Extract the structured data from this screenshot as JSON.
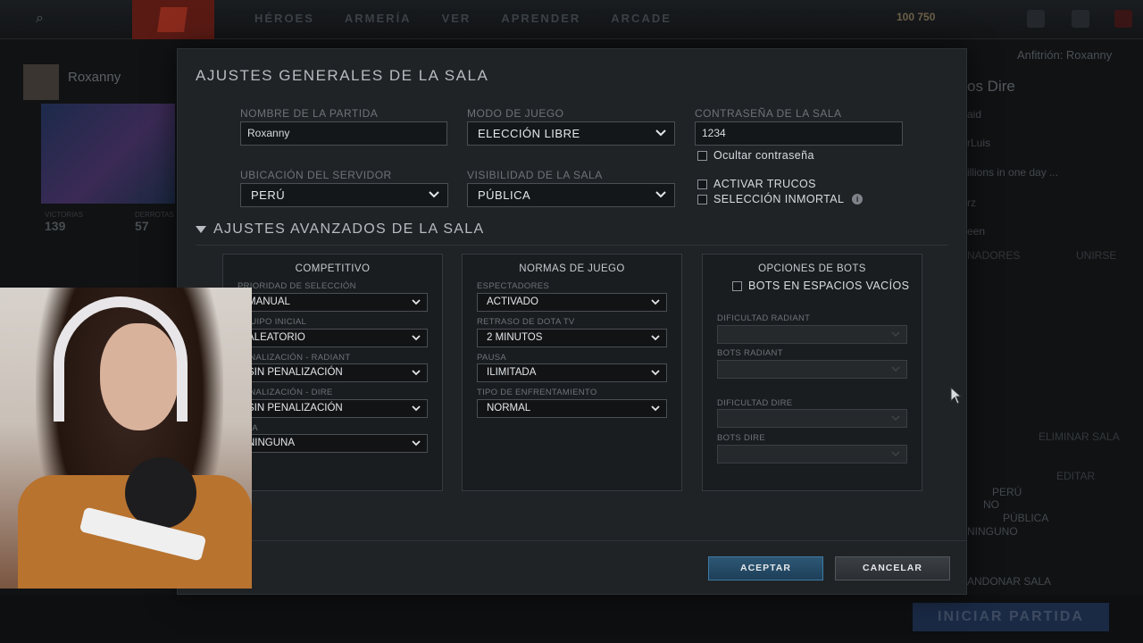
{
  "client": {
    "nav": [
      "HÉROES",
      "ARMERÍA",
      "VER",
      "APRENDER",
      "ARCADE"
    ],
    "coins": "100  750",
    "profile_name": "Roxanny",
    "stats": [
      {
        "label": "VICTORIAS",
        "value": "139"
      },
      {
        "label": "DERROTAS",
        "value": "57"
      }
    ],
    "lobby": {
      "host": "Anfitrión: Roxanny",
      "dire_title": "os Dire",
      "rows": [
        "aid",
        "rLuis",
        "illions in one day ...",
        "rz",
        "een",
        "NADORES",
        "UNIRSE",
        "ELIMINAR SALA",
        "EDITAR",
        "PERÚ",
        "NO",
        "PÚBLICA",
        "NINGUNO",
        "ANDONAR SALA"
      ]
    },
    "start_button": "INICIAR PARTIDA"
  },
  "dialog": {
    "title": "AJUSTES GENERALES DE LA SALA",
    "game_name": {
      "label": "NOMBRE DE LA PARTIDA",
      "value": "Roxanny"
    },
    "game_mode": {
      "label": "MODO DE JUEGO",
      "value": "ELECCIÓN LIBRE"
    },
    "password": {
      "label": "CONTRASEÑA DE LA SALA",
      "value": "1234"
    },
    "hide_password": "Ocultar contraseña",
    "server_location": {
      "label": "UBICACIÓN DEL SERVIDOR",
      "value": "PERÚ"
    },
    "visibility": {
      "label": "VISIBILIDAD DE LA SALA",
      "value": "PÚBLICA"
    },
    "enable_cheats": "ACTIVAR TRUCOS",
    "immortal_draft": "SELECCIÓN INMORTAL",
    "advanced_title": "AJUSTES AVANZADOS DE LA SALA",
    "competitive": {
      "title": "COMPETITIVO",
      "fields": [
        {
          "label": "PRIORIDAD DE SELECCIÓN",
          "value": "MANUAL"
        },
        {
          "label": "EQUIPO INICIAL",
          "value": "ALEATORIO"
        },
        {
          "label": "PENALIZACIÓN - RADIANT",
          "value": "SIN PENALIZACIÓN"
        },
        {
          "label": "PENALIZACIÓN - DIRE",
          "value": "SIN PENALIZACIÓN"
        },
        {
          "label": "LIGA",
          "value": "NINGUNA"
        }
      ]
    },
    "game_rules": {
      "title": "NORMAS DE JUEGO",
      "fields": [
        {
          "label": "ESPECTADORES",
          "value": "ACTIVADO"
        },
        {
          "label": "RETRASO DE DOTA TV",
          "value": "2 MINUTOS"
        },
        {
          "label": "PAUSA",
          "value": "ILIMITADA"
        },
        {
          "label": "TIPO DE ENFRENTAMIENTO",
          "value": "NORMAL"
        }
      ]
    },
    "bots": {
      "title": "OPCIONES DE BOTS",
      "fill_bots": "BOTS EN ESPACIOS VACÍOS",
      "fields": [
        {
          "label": "DIFICULTAD RADIANT",
          "value": ""
        },
        {
          "label": "BOTS RADIANT",
          "value": ""
        },
        {
          "label": "DIFICULTAD DIRE",
          "value": ""
        },
        {
          "label": "BOTS DIRE",
          "value": ""
        }
      ]
    },
    "accept": "ACEPTAR",
    "cancel": "CANCELAR"
  }
}
